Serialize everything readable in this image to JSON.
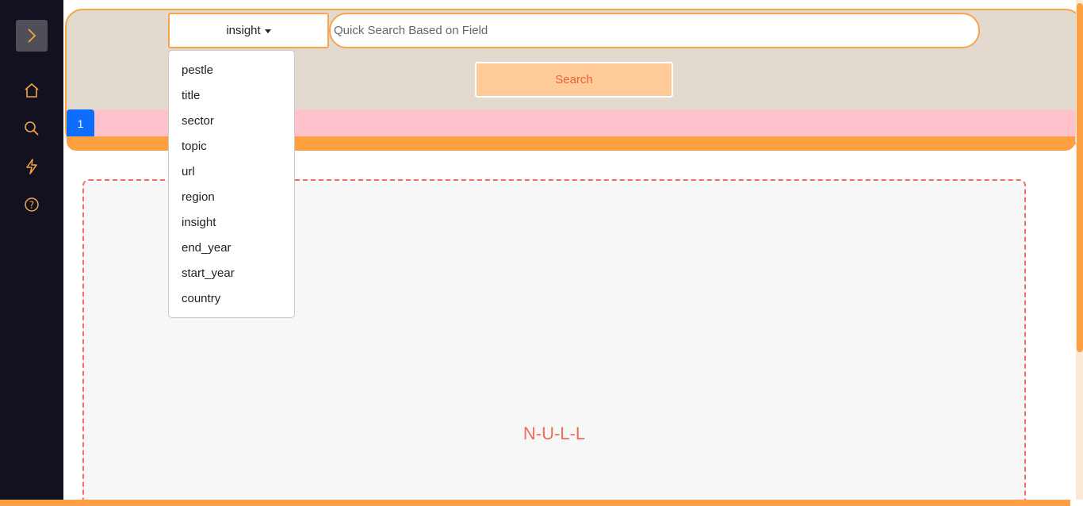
{
  "sidebar": {
    "toggle_icon": "chevron-right-icon",
    "icons": [
      "home-icon",
      "search-icon",
      "bolt-icon",
      "help-icon"
    ],
    "icon_color": "#f8a448"
  },
  "header": {
    "dropdown_selected": "insight",
    "search_placeholder": "Quick Search Based on Field",
    "search_button": "Search",
    "accent": "#f8a448"
  },
  "pagination": {
    "current_page": "1"
  },
  "dropdown_menu": {
    "items": [
      "pestle",
      "title",
      "sector",
      "topic",
      "url",
      "region",
      "insight",
      "end_year",
      "start_year",
      "country"
    ]
  },
  "result": {
    "empty_text": "N-U-L-L"
  }
}
